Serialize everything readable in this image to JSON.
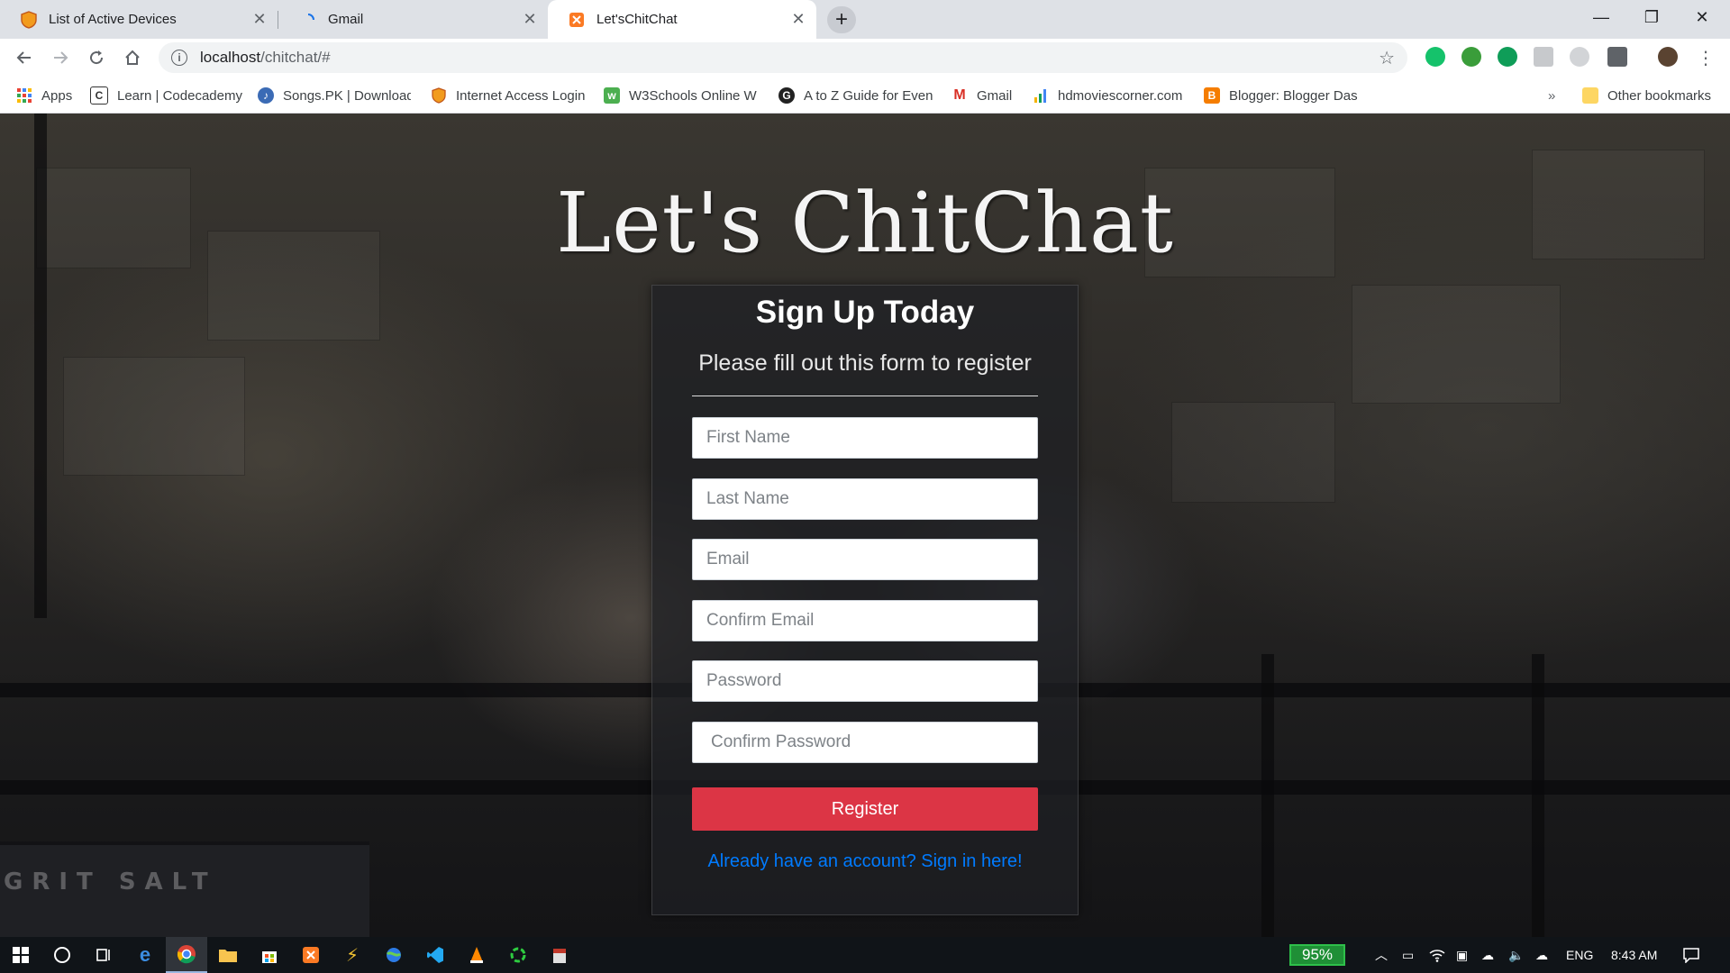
{
  "browser": {
    "tabs": [
      {
        "title": "List of Active Devices",
        "icon": "shield-icon"
      },
      {
        "title": "Gmail",
        "icon": "loading-icon"
      },
      {
        "title": "Let'sChitChat",
        "icon": "xampp-icon"
      }
    ],
    "url_host": "localhost",
    "url_path": "/chitchat/#",
    "bookmarks": [
      {
        "label": "Apps",
        "icon": "apps-grid-icon"
      },
      {
        "label": "Learn | Codecademy",
        "icon": "codecademy-icon"
      },
      {
        "label": "Songs.PK | Download",
        "icon": "songspk-icon"
      },
      {
        "label": "Internet Access Login",
        "icon": "shield-icon"
      },
      {
        "label": "W3Schools Online W",
        "icon": "w3schools-icon"
      },
      {
        "label": "A to Z Guide for Even",
        "icon": "g-icon"
      },
      {
        "label": "Gmail",
        "icon": "gmail-icon"
      },
      {
        "label": "hdmoviescorner.com",
        "icon": "bar-chart-icon"
      },
      {
        "label": "Blogger: Blogger Das",
        "icon": "blogger-icon"
      }
    ],
    "overflow": "»",
    "other_bookmarks": "Other bookmarks"
  },
  "page": {
    "brand": "Let's ChitChat",
    "form": {
      "heading": "Sign Up Today",
      "subheading": "Please fill out this form to register",
      "fields": {
        "first_name": "First Name",
        "last_name": "Last Name",
        "email": "Email",
        "confirm_email": "Confirm Email",
        "password": "Password",
        "confirm_password": "Confirm Password"
      },
      "register": "Register",
      "signin_link": "Already have an account? Sign in here!"
    },
    "background_text": "GRIT SALT",
    "colors": {
      "register": "#dc3545",
      "link": "#007bff"
    }
  },
  "taskbar": {
    "battery": "95%",
    "language": "ENG",
    "time": "8:43 AM"
  }
}
